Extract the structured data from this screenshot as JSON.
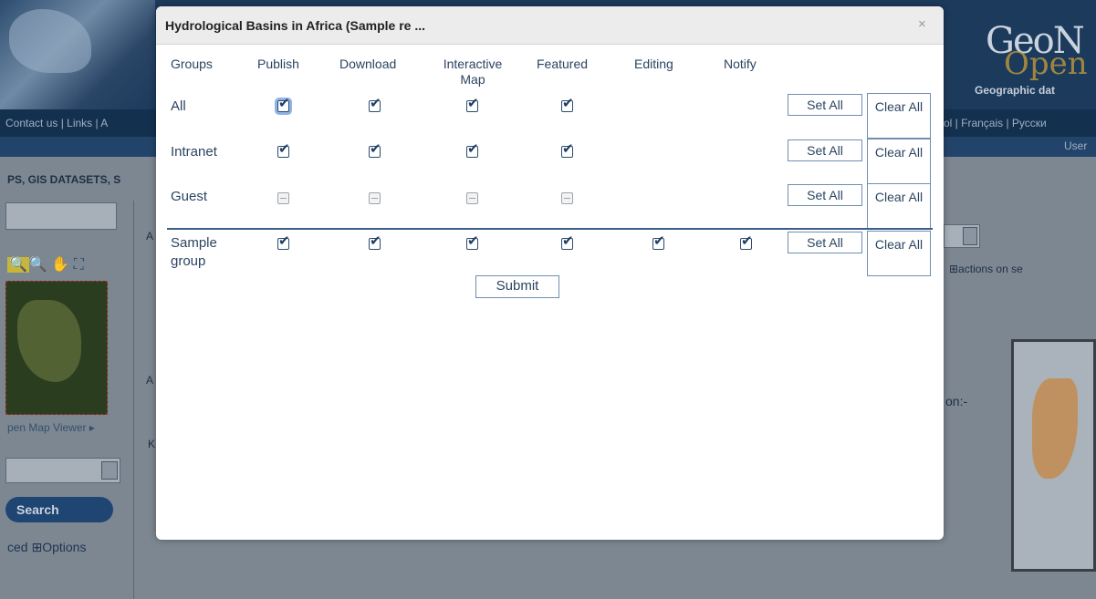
{
  "background": {
    "nav_links_left": "Contact us | Links | A",
    "nav_links_right": "ol | Français | Русски",
    "user_label": "User",
    "logo_text_top": "GeoN",
    "logo_text_bottom": "Open",
    "tagline": "Geographic dat",
    "section_heading": "PS, GIS DATASETS, S",
    "open_map_viewer": "pen Map Viewer ▸",
    "search_button": "Search",
    "options_link": "ced  ⊞Options",
    "actions_label": "⊞actions on se",
    "partial_text_on": "on:-",
    "side_letter_1": "A",
    "side_letter_2": "A",
    "side_letter_3": "K"
  },
  "modal": {
    "title": "Hydrological Basins in Africa (Sample re ...",
    "close_glyph": "×",
    "columns": {
      "groups": "Groups",
      "publish": "Publish",
      "download": "Download",
      "interactive_map": "Interactive Map",
      "featured": "Featured",
      "editing": "Editing",
      "notify": "Notify"
    },
    "rows": [
      {
        "label": "All",
        "publish": true,
        "download": true,
        "interactive_map": true,
        "featured": true
      },
      {
        "label": "Intranet",
        "publish": true,
        "download": true,
        "interactive_map": true,
        "featured": true
      },
      {
        "label": "Guest",
        "publish": false,
        "download": false,
        "interactive_map": false,
        "featured": false
      },
      {
        "label": "Sample group",
        "publish": true,
        "download": true,
        "interactive_map": true,
        "featured": true,
        "editing": true,
        "notify": true
      }
    ],
    "set_all_label": "Set All",
    "clear_all_label": "Clear All",
    "submit_label": "Submit"
  },
  "colors": {
    "accent": "#2b4461",
    "button_border": "#6f8eb3",
    "overlay": "#7d8791"
  }
}
